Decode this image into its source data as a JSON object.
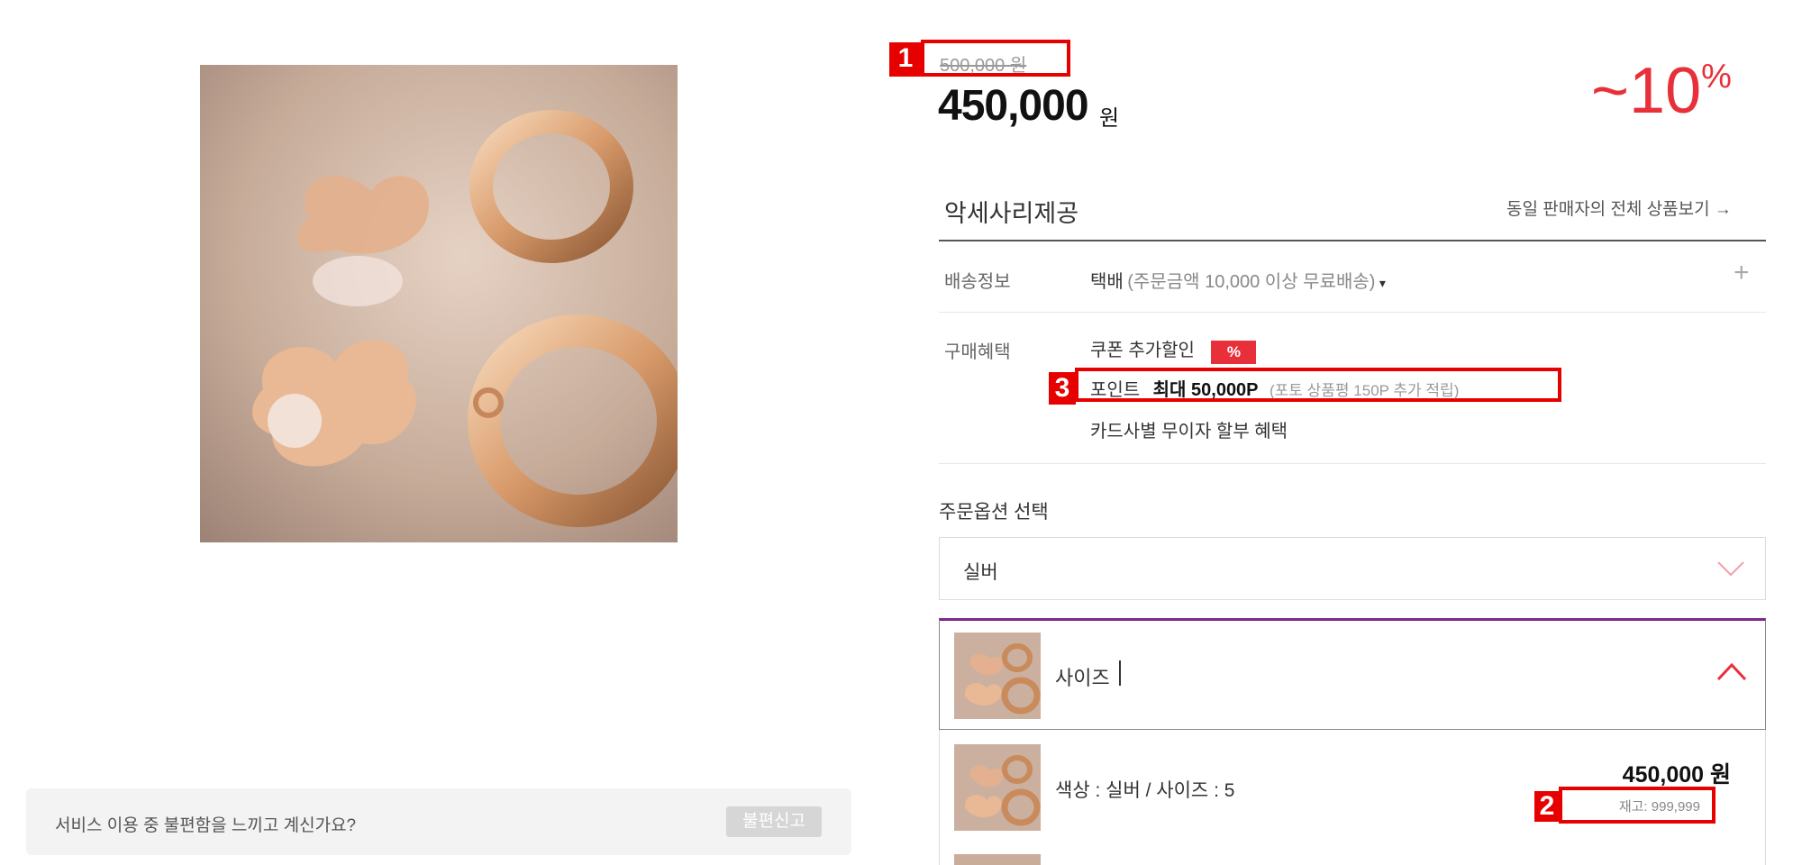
{
  "price": {
    "original": "500,000 원",
    "sale": "450,000",
    "sale_unit": "원",
    "discount": "~10",
    "discount_unit": "%"
  },
  "seller": {
    "name": "악세사리제공",
    "all_products_link": "동일 판매자의 전체 상품보기 →"
  },
  "shipping": {
    "label": "배송정보",
    "method": "택배",
    "note": "(주문금액 10,000 이상 무료배송)",
    "dropdown_arrow": "▾",
    "expand": "+"
  },
  "benefits": {
    "label": "구매혜택",
    "coupon": "쿠폰 추가할인",
    "coupon_badge": "%",
    "point_label": "포인트",
    "point_value": "최대 50,000P",
    "point_note": "(포토 상품평 150P 추가 적립)",
    "card": "카드사별 무이자 할부 혜택"
  },
  "order_option": {
    "title": "주문옵션 선택",
    "color_selected": "실버",
    "size_placeholder": "사이즈"
  },
  "selected_item": {
    "desc": "색상 : 실버 / 사이즈 : 5",
    "price": "450,000 원",
    "stock": "재고: 999,999"
  },
  "markers": {
    "m1": "1",
    "m2": "2",
    "m3": "3"
  },
  "service": {
    "message": "서비스 이용 중 불편함을 느끼고 계신가요?",
    "report_button": "불편신고"
  },
  "colors": {
    "accent_red": "#e8303a",
    "highlight_red": "#e60000",
    "option_border": "#7a2a8a"
  }
}
